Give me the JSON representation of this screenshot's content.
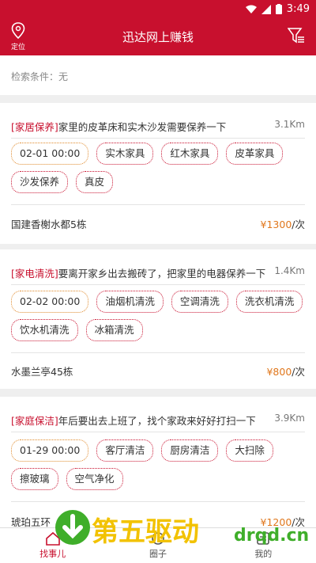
{
  "status": {
    "time": "3:49"
  },
  "appbar": {
    "title": "迅达网上赚钱",
    "location_label": "定位"
  },
  "criteria": {
    "text": "检索条件：无"
  },
  "orders": [
    {
      "category": "[家居保养]",
      "desc": "家里的皮革床和实木沙发需要保养一下",
      "distance": "3.1Km",
      "date": "02-01 00:00",
      "tags": [
        "实木家具",
        "红木家具",
        "皮革家具",
        "沙发保养",
        "真皮"
      ],
      "address": "国建香榭水都5栋",
      "price": "¥1300",
      "unit": "/次"
    },
    {
      "category": "[家电清洗]",
      "desc": "要离开家乡出去搬砖了，把家里的电器保养一下",
      "distance": "1.4Km",
      "date": "02-02 00:00",
      "tags": [
        "油烟机清洗",
        "空调清洗",
        "洗衣机清洗",
        "饮水机清洗",
        "冰箱清洗"
      ],
      "address": "水墨兰亭45栋",
      "price": "¥800",
      "unit": "/次"
    },
    {
      "category": "[家庭保洁]",
      "desc": "年后要出去上班了，找个家政来好好打扫一下",
      "distance": "3.9Km",
      "date": "01-29 00:00",
      "tags": [
        "客厅清洁",
        "厨房清洁",
        "大扫除",
        "擦玻璃",
        "空气净化"
      ],
      "address": "琥珀五环",
      "price": "¥1200",
      "unit": "/次"
    }
  ],
  "nav": [
    {
      "label": "找事儿",
      "icon": "home-icon",
      "active": true
    },
    {
      "label": "圈子",
      "icon": "circle-icon",
      "active": false
    },
    {
      "label": "我的",
      "icon": "user-icon",
      "active": false
    }
  ],
  "watermark": {
    "text": "第五驱动",
    "domain": "drqd.cn"
  },
  "colors": {
    "brand": "#c8102e",
    "price": "#e0771c",
    "date_border": "#e08a2c"
  }
}
